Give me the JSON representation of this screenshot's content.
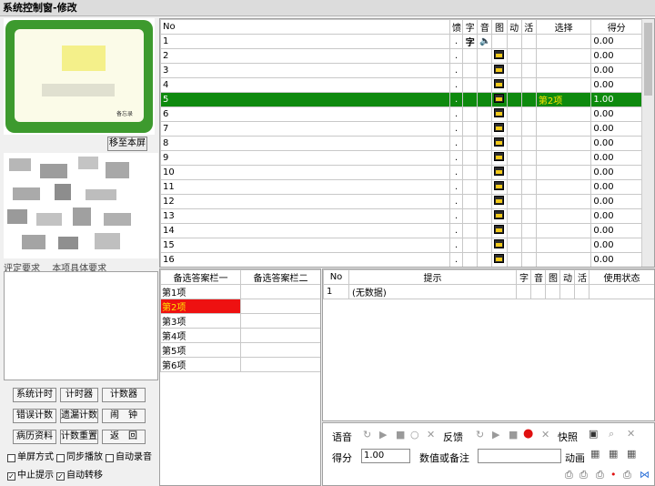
{
  "window": {
    "title": "系统控制窗-修改"
  },
  "preview": {
    "card_caption": "备忘录",
    "move_button": "移至本屏"
  },
  "left_tabs": [
    "评定要求",
    "本项具体要求"
  ],
  "buttons": {
    "row1": [
      "系统计时",
      "计时器",
      "计数器"
    ],
    "row2": [
      "错误计数",
      "遗漏计数",
      "闹　钟"
    ],
    "row3": [
      "病历资料",
      "计数重置",
      "返　回"
    ]
  },
  "checkboxes": [
    {
      "label": "单屏方式",
      "checked": false
    },
    {
      "label": "同步播放",
      "checked": false
    },
    {
      "label": "自动录音",
      "checked": false
    },
    {
      "label": "中止提示",
      "checked": true
    },
    {
      "label": "自动转移",
      "checked": true
    }
  ],
  "question_table": {
    "headers": [
      "No",
      "",
      "馈",
      "字",
      "音",
      "图",
      "动",
      "活",
      "选择",
      "得分"
    ],
    "rows": [
      {
        "no": "1",
        "dot": ".",
        "zi": "字",
        "yin": "speaker",
        "tu": "",
        "choice": "",
        "score": "0.00"
      },
      {
        "no": "2",
        "dot": ".",
        "zi": "",
        "yin": "",
        "tu": "image",
        "choice": "",
        "score": "0.00"
      },
      {
        "no": "3",
        "dot": ".",
        "zi": "",
        "yin": "",
        "tu": "image",
        "choice": "",
        "score": "0.00"
      },
      {
        "no": "4",
        "dot": ".",
        "zi": "",
        "yin": "",
        "tu": "image",
        "choice": "",
        "score": "0.00"
      },
      {
        "no": "5",
        "dot": ".",
        "zi": "",
        "yin": "",
        "tu": "image",
        "choice": "第2项",
        "score": "1.00"
      },
      {
        "no": "6",
        "dot": ".",
        "zi": "",
        "yin": "",
        "tu": "image",
        "choice": "",
        "score": "0.00"
      },
      {
        "no": "7",
        "dot": ".",
        "zi": "",
        "yin": "",
        "tu": "image",
        "choice": "",
        "score": "0.00"
      },
      {
        "no": "8",
        "dot": ".",
        "zi": "",
        "yin": "",
        "tu": "image",
        "choice": "",
        "score": "0.00"
      },
      {
        "no": "9",
        "dot": ".",
        "zi": "",
        "yin": "",
        "tu": "image",
        "choice": "",
        "score": "0.00"
      },
      {
        "no": "10",
        "dot": ".",
        "zi": "",
        "yin": "",
        "tu": "image",
        "choice": "",
        "score": "0.00"
      },
      {
        "no": "11",
        "dot": ".",
        "zi": "",
        "yin": "",
        "tu": "image",
        "choice": "",
        "score": "0.00"
      },
      {
        "no": "12",
        "dot": ".",
        "zi": "",
        "yin": "",
        "tu": "image",
        "choice": "",
        "score": "0.00"
      },
      {
        "no": "13",
        "dot": ".",
        "zi": "",
        "yin": "",
        "tu": "image",
        "choice": "",
        "score": "0.00"
      },
      {
        "no": "14",
        "dot": ".",
        "zi": "",
        "yin": "",
        "tu": "image",
        "choice": "",
        "score": "0.00"
      },
      {
        "no": "15",
        "dot": ".",
        "zi": "",
        "yin": "",
        "tu": "image",
        "choice": "",
        "score": "0.00"
      },
      {
        "no": "16",
        "dot": ".",
        "zi": "",
        "yin": "",
        "tu": "image",
        "choice": "",
        "score": "0.00"
      }
    ],
    "selected_row": 5
  },
  "alt_answers": {
    "headers": [
      "备选答案栏一",
      "备选答案栏二"
    ],
    "items": [
      "第1项",
      "第2项",
      "第3项",
      "第4项",
      "第5项",
      "第6项"
    ],
    "selected": 1
  },
  "hint_table": {
    "headers": [
      "No",
      "提示",
      "字",
      "音",
      "图",
      "动",
      "活",
      "使用状态"
    ],
    "rows": [
      {
        "no": "1",
        "text": "(无数据)"
      }
    ]
  },
  "controls": {
    "voice_label": "语音",
    "feedback_label": "反馈",
    "snapshot_label": "快照",
    "score_label": "得分",
    "score_value": "1.00",
    "value_label": "数值或备注",
    "value_input": "",
    "animation_label": "动画"
  },
  "colors": {
    "selected_row": "#0e8a0e",
    "selected_text": "#ffe400",
    "alt_selected": "#ee1111",
    "frame_green": "#3d9a2e"
  }
}
